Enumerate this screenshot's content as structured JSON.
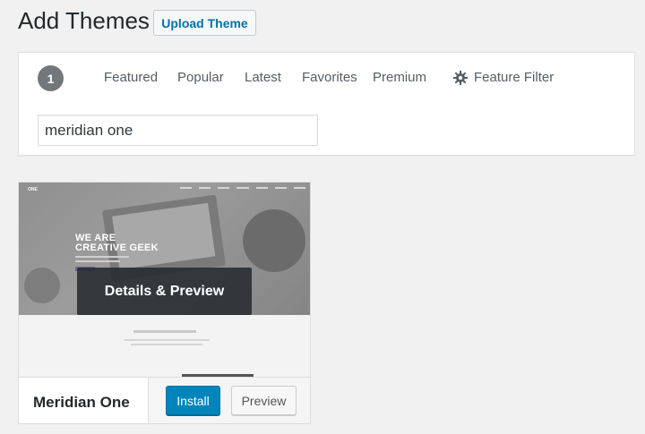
{
  "header": {
    "title": "Add Themes",
    "upload_button": "Upload Theme"
  },
  "filter": {
    "count": "1",
    "tabs": [
      "Featured",
      "Popular",
      "Latest",
      "Favorites",
      "Premium"
    ],
    "feature_filter": "Feature Filter",
    "search_value": "meridian one"
  },
  "theme": {
    "name": "Meridian One",
    "overlay_label": "Details & Preview",
    "install_label": "Install",
    "preview_label": "Preview",
    "screenshot": {
      "logo": "ONE",
      "headline_line1": "WE ARE",
      "headline_line2": "CREATIVE GEEK"
    }
  },
  "colors": {
    "primary": "#0085ba",
    "link": "#0073aa",
    "background": "#f1f1f1"
  },
  "icons": {
    "feature_filter": "gear-icon"
  }
}
